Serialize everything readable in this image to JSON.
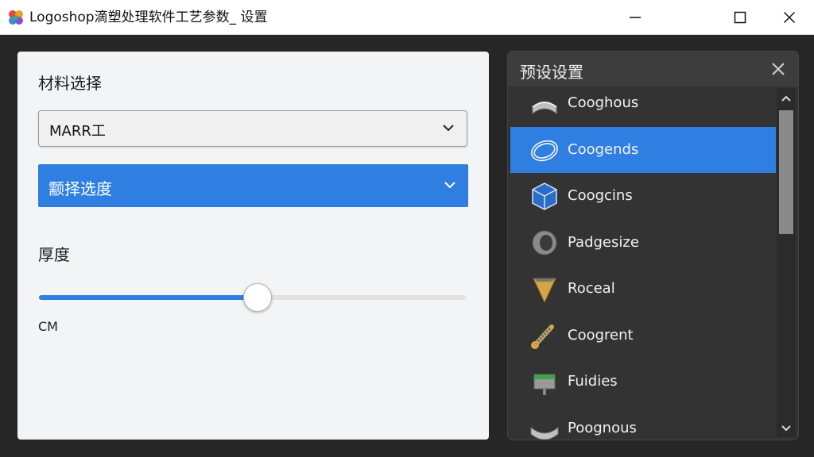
{
  "window": {
    "title": "Logoshop滴塑处理软件工艺参数_ 设置"
  },
  "left_panel": {
    "material_label": "材料选择",
    "material_select": {
      "value": "MARR工"
    },
    "option_select": {
      "value": "颥择选度"
    },
    "thickness_label": "厚度",
    "thickness_slider": {
      "value_fraction": 0.51
    },
    "unit": "CM"
  },
  "presets": {
    "title": "预设设置",
    "selected_index": 1,
    "items": [
      {
        "label": "Cooghous",
        "icon": "curved-sheet-icon"
      },
      {
        "label": "Coogends",
        "icon": "ring-icon"
      },
      {
        "label": "Coogcins",
        "icon": "cube-icon"
      },
      {
        "label": "Padgesize",
        "icon": "cylinder-icon"
      },
      {
        "label": "Roceal",
        "icon": "cone-icon"
      },
      {
        "label": "Coogrent",
        "icon": "coil-icon"
      },
      {
        "label": "Fuidies",
        "icon": "spool-icon"
      },
      {
        "label": "Poognous",
        "icon": "curved-tray-icon"
      }
    ]
  },
  "colors": {
    "accent": "#2f7fe3",
    "panel_dark": "#333333",
    "panel_light": "#f3f4f5"
  }
}
